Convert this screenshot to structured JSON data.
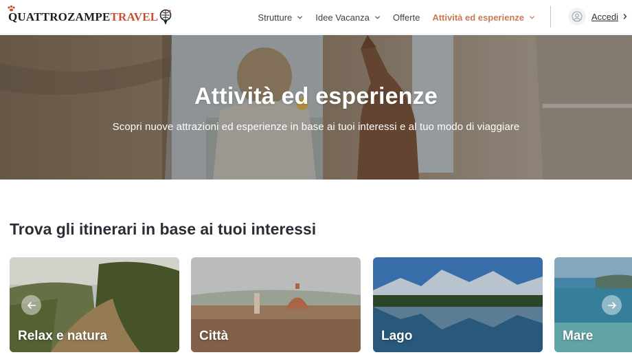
{
  "brand": {
    "name_part1": "QUATTROZAMPE",
    "name_part2": "TRAVEL",
    "accent": "#c7512d"
  },
  "nav": {
    "items": [
      {
        "label": "Strutture",
        "has_dropdown": true
      },
      {
        "label": "Idee Vacanza",
        "has_dropdown": true
      },
      {
        "label": "Offerte",
        "has_dropdown": false
      },
      {
        "label": "Attività ed esperienze",
        "has_dropdown": true,
        "active": true
      }
    ],
    "active_color": "#c97a53"
  },
  "account": {
    "label": "Accedi",
    "icon": "user-icon"
  },
  "hero": {
    "title": "Attività ed esperienze",
    "subtitle": "Scopri nuove attrazioni ed esperienze in base ai tuoi interessi e al tuo modo di viaggiare"
  },
  "interests": {
    "title": "Trova gli itinerari in base ai tuoi interessi",
    "cards": [
      {
        "label": "Relax e natura"
      },
      {
        "label": "Città"
      },
      {
        "label": "Lago"
      },
      {
        "label": "Mare"
      }
    ],
    "prev_icon": "arrow-left-icon",
    "next_icon": "arrow-right-icon"
  }
}
